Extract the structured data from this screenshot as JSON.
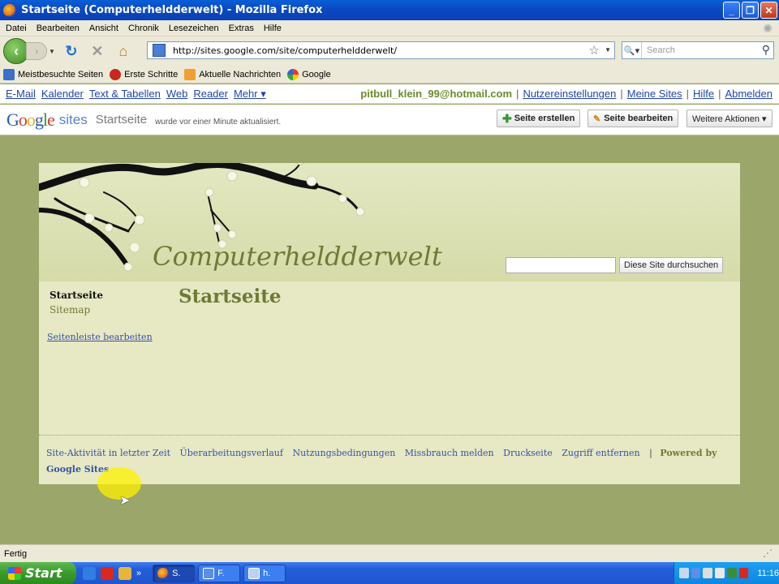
{
  "window": {
    "title": "Startseite (Computerheldderwelt) - Mozilla Firefox"
  },
  "menu": [
    "Datei",
    "Bearbeiten",
    "Ansicht",
    "Chronik",
    "Lesezeichen",
    "Extras",
    "Hilfe"
  ],
  "nav": {
    "url": "http://sites.google.com/site/computerheldderwelt/",
    "search_placeholder": "Search"
  },
  "bookmarks": [
    "Meistbesuchte Seiten",
    "Erste Schritte",
    "Aktuelle Nachrichten",
    "Google"
  ],
  "gbar": {
    "links": [
      "E-Mail",
      "Kalender",
      "Text & Tabellen",
      "Web",
      "Reader"
    ],
    "more": "Mehr ▾",
    "email": "pitbull_klein_99@hotmail.com",
    "right_links": [
      "Nutzereinstellungen",
      "Meine Sites",
      "Hilfe",
      "Abmelden"
    ]
  },
  "sites_header": {
    "sites_word": "sites",
    "page_name": "Startseite",
    "updated": "wurde vor einer Minute aktualisiert.",
    "create_label": "Seite erstellen",
    "edit_label": "Seite bearbeiten",
    "more_label": "Weitere Aktionen ▾"
  },
  "site": {
    "title": "Computerheldderwelt",
    "search_button": "Diese Site durchsuchen",
    "sidebar": {
      "home": "Startseite",
      "sitemap": "Sitemap",
      "edit": "Seitenleiste bearbeiten"
    },
    "heading": "Startseite",
    "footer_links": [
      "Site-Aktivität in letzter Zeit",
      "Überarbeitungsverlauf",
      "Nutzungsbedingungen",
      "Missbrauch melden",
      "Druckseite",
      "Zugriff entfernen"
    ],
    "powered_by": "Powered by",
    "google_sites": "Google Sites"
  },
  "status": {
    "text": "Fertig"
  },
  "taskbar": {
    "start": "Start",
    "tasks": [
      "S.",
      "F.",
      "h."
    ],
    "clock": "11:16"
  }
}
